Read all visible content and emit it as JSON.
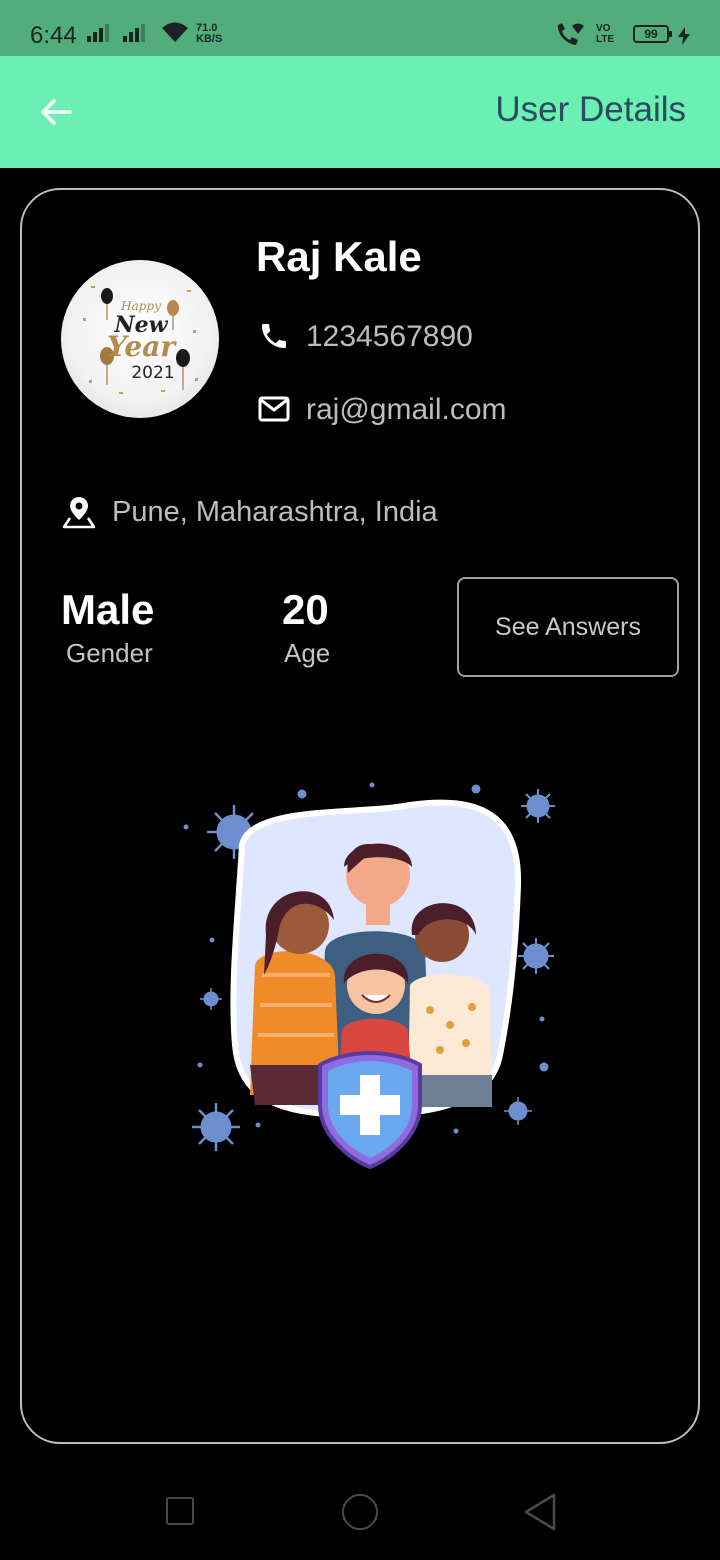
{
  "status_bar": {
    "time": "6:44",
    "speed_value": "71.0",
    "speed_unit": "KB/S",
    "volte_top": "VO",
    "volte_bottom": "LTE",
    "battery": "99"
  },
  "app_bar": {
    "title": "User Details",
    "back_icon": "arrow-left-icon"
  },
  "avatar": {
    "line1": "Happy",
    "line2": "New",
    "line3": "Year",
    "line4": "2021"
  },
  "user": {
    "name": "Raj Kale",
    "phone": "1234567890",
    "email": "raj@gmail.com",
    "location": "Pune, Maharashtra, India"
  },
  "stats": {
    "gender_value": "Male",
    "gender_label": "Gender",
    "age_value": "20",
    "age_label": "Age"
  },
  "actions": {
    "see_answers": "See Answers"
  },
  "colors": {
    "status_bar": "#52ad7c",
    "app_bar": "#69f0b2",
    "title": "#2d4a5e",
    "background": "#000000"
  }
}
